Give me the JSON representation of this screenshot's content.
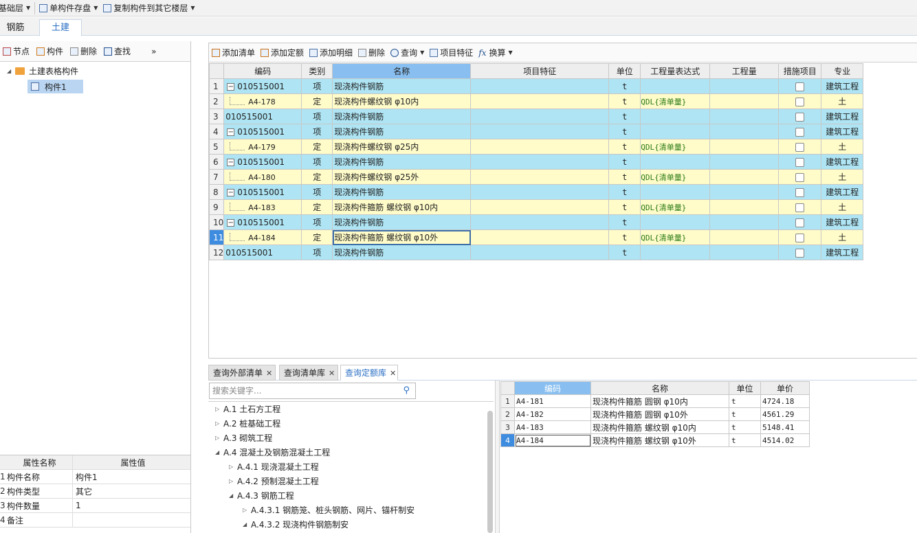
{
  "topbar": {
    "floor": "基础层",
    "save": "单构件存盘",
    "copy": "复制构件到其它楼层"
  },
  "tabs": [
    {
      "label": "钢筋"
    },
    {
      "label": "土建"
    }
  ],
  "left_toolbar": {
    "node": "节点",
    "component": "构件",
    "delete": "删除",
    "find": "查找",
    "more": "»"
  },
  "tree": {
    "root": "土建表格构件",
    "child": "构件1"
  },
  "props": {
    "headers": [
      "属性名称",
      "属性值"
    ],
    "rows": [
      {
        "n": "1",
        "name": "构件名称",
        "value": "构件1"
      },
      {
        "n": "2",
        "name": "构件类型",
        "value": "其它"
      },
      {
        "n": "3",
        "name": "构件数量",
        "value": "1"
      },
      {
        "n": "4",
        "name": "备注",
        "value": ""
      }
    ]
  },
  "right_toolbar": {
    "add_list": "添加清单",
    "add_quota": "添加定额",
    "add_detail": "添加明细",
    "delete": "删除",
    "query": "查询",
    "feature": "项目特征",
    "convert": "换算"
  },
  "grid": {
    "headers": [
      "编码",
      "类别",
      "名称",
      "项目特征",
      "单位",
      "工程量表达式",
      "工程量",
      "措施项目",
      "专业"
    ],
    "rows": [
      {
        "n": "1",
        "type": "qd",
        "tree": "minus",
        "code": "010515001",
        "cat": "项",
        "name": "现浇构件钢筋",
        "feature": "",
        "unit": "t",
        "expr": "",
        "qty": "",
        "major": "建筑工程"
      },
      {
        "n": "2",
        "type": "de",
        "tree": "child",
        "code": "A4-178",
        "cat": "定",
        "name": "现浇构件螺纹钢 φ10内",
        "feature": "",
        "unit": "t",
        "expr": "QDL{清单量}",
        "qty": "",
        "major": "土"
      },
      {
        "n": "3",
        "type": "qd",
        "tree": "none",
        "code": "010515001",
        "cat": "项",
        "name": "现浇构件钢筋",
        "feature": "",
        "unit": "t",
        "expr": "",
        "qty": "",
        "major": "建筑工程"
      },
      {
        "n": "4",
        "type": "qd",
        "tree": "minus",
        "code": "010515001",
        "cat": "项",
        "name": "现浇构件钢筋",
        "feature": "",
        "unit": "t",
        "expr": "",
        "qty": "",
        "major": "建筑工程"
      },
      {
        "n": "5",
        "type": "de",
        "tree": "child",
        "code": "A4-179",
        "cat": "定",
        "name": "现浇构件螺纹钢 φ25内",
        "feature": "",
        "unit": "t",
        "expr": "QDL{清单量}",
        "qty": "",
        "major": "土"
      },
      {
        "n": "6",
        "type": "qd",
        "tree": "minus",
        "code": "010515001",
        "cat": "项",
        "name": "现浇构件钢筋",
        "feature": "",
        "unit": "t",
        "expr": "",
        "qty": "",
        "major": "建筑工程"
      },
      {
        "n": "7",
        "type": "de",
        "tree": "child",
        "code": "A4-180",
        "cat": "定",
        "name": "现浇构件螺纹钢 φ25外",
        "feature": "",
        "unit": "t",
        "expr": "QDL{清单量}",
        "qty": "",
        "major": "土"
      },
      {
        "n": "8",
        "type": "qd",
        "tree": "minus",
        "code": "010515001",
        "cat": "项",
        "name": "现浇构件钢筋",
        "feature": "",
        "unit": "t",
        "expr": "",
        "qty": "",
        "major": "建筑工程"
      },
      {
        "n": "9",
        "type": "de",
        "tree": "child",
        "code": "A4-183",
        "cat": "定",
        "name": "现浇构件箍筋 螺纹钢 φ10内",
        "feature": "",
        "unit": "t",
        "expr": "QDL{清单量}",
        "qty": "",
        "major": "土"
      },
      {
        "n": "10",
        "type": "qd",
        "tree": "minus",
        "code": "010515001",
        "cat": "项",
        "name": "现浇构件钢筋",
        "feature": "",
        "unit": "t",
        "expr": "",
        "qty": "",
        "major": "建筑工程"
      },
      {
        "n": "11",
        "type": "de",
        "tree": "child",
        "code": "A4-184",
        "cat": "定",
        "name": "现浇构件箍筋 螺纹钢 φ10外",
        "feature": "",
        "unit": "t",
        "expr": "QDL{清单量}",
        "qty": "",
        "major": "土",
        "active": true
      },
      {
        "n": "12",
        "type": "qd",
        "tree": "none",
        "code": "010515001",
        "cat": "项",
        "name": "现浇构件钢筋",
        "feature": "",
        "unit": "t",
        "expr": "",
        "qty": "",
        "major": "建筑工程"
      }
    ]
  },
  "bottom_tabs": [
    {
      "label": "查询外部清单"
    },
    {
      "label": "查询清单库"
    },
    {
      "label": "查询定额库"
    }
  ],
  "search": {
    "placeholder": "搜索关键字..."
  },
  "lib_tree": [
    {
      "label": "A.1 土石方工程",
      "level": 0,
      "open": false
    },
    {
      "label": "A.2 桩基础工程",
      "level": 0,
      "open": false
    },
    {
      "label": "A.3 砌筑工程",
      "level": 0,
      "open": false
    },
    {
      "label": "A.4 混凝土及钢筋混凝土工程",
      "level": 0,
      "open": true
    },
    {
      "label": "A.4.1 现浇混凝土工程",
      "level": 1,
      "open": false
    },
    {
      "label": "A.4.2 预制混凝土工程",
      "level": 1,
      "open": false
    },
    {
      "label": "A.4.3 钢筋工程",
      "level": 1,
      "open": true
    },
    {
      "label": "A.4.3.1 钢筋笼、桩头钢筋、网片、锚杆制安",
      "level": 2,
      "open": false
    },
    {
      "label": "A.4.3.2 现浇构件钢筋制安",
      "level": 2,
      "open": true
    }
  ],
  "quota_grid": {
    "headers": [
      "编码",
      "名称",
      "单位",
      "单价"
    ],
    "rows": [
      {
        "n": "1",
        "code": "A4-181",
        "name": "现浇构件箍筋 圆钢 φ10内",
        "unit": "t",
        "price": "4724.18"
      },
      {
        "n": "2",
        "code": "A4-182",
        "name": "现浇构件箍筋 圆钢 φ10外",
        "unit": "t",
        "price": "4561.29"
      },
      {
        "n": "3",
        "code": "A4-183",
        "name": "现浇构件箍筋 螺纹钢 φ10内",
        "unit": "t",
        "price": "5148.41"
      },
      {
        "n": "4",
        "code": "A4-184",
        "name": "现浇构件箍筋 螺纹钢 φ10外",
        "unit": "t",
        "price": "4514.02",
        "active": true
      }
    ]
  },
  "colors": {
    "qd_row": "#aee4f3",
    "de_row": "#fffcc9",
    "header_selected": "#88bff0",
    "active_row": "#3e8ce0"
  }
}
